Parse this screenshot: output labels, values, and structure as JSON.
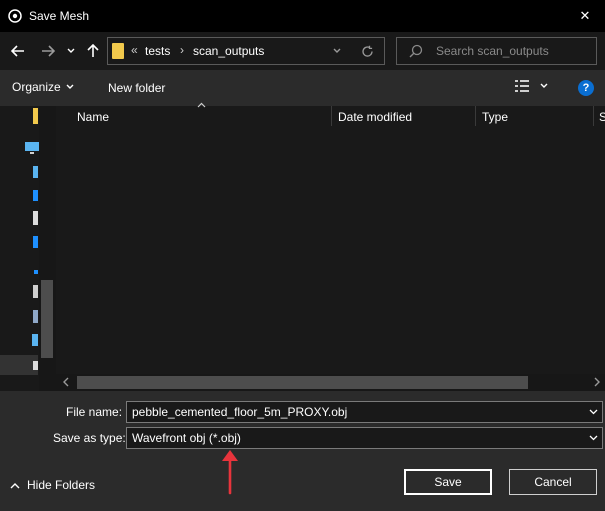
{
  "window": {
    "title": "Save Mesh",
    "close_glyph": "✕"
  },
  "nav": {
    "back_icon": "arrow-left-icon",
    "forward_icon": "arrow-right-icon",
    "recent_icon": "chevron-down-icon",
    "up_icon": "arrow-up-icon",
    "breadcrumb_overflow": "«",
    "breadcrumb": [
      "tests",
      "scan_outputs"
    ],
    "breadcrumb_sep": "›",
    "refresh_icon": "refresh-icon",
    "search_placeholder": "Search scan_outputs"
  },
  "toolbar": {
    "organize_label": "Organize",
    "new_folder_label": "New folder",
    "help_label": "?"
  },
  "columns": [
    "Name",
    "Date modified",
    "Type",
    "S"
  ],
  "form": {
    "file_name_label": "File name:",
    "file_name_value": "pebble_cemented_floor_5m_PROXY.obj",
    "save_type_label": "Save as type:",
    "save_type_value": "Wavefront obj (*.obj)"
  },
  "footer": {
    "hide_folders_label": "Hide Folders",
    "save_label": "Save",
    "cancel_label": "Cancel"
  },
  "colors": {
    "accent": "#0a6ed1",
    "annotation_arrow": "#e8343c",
    "folder": "#f2c94c"
  }
}
